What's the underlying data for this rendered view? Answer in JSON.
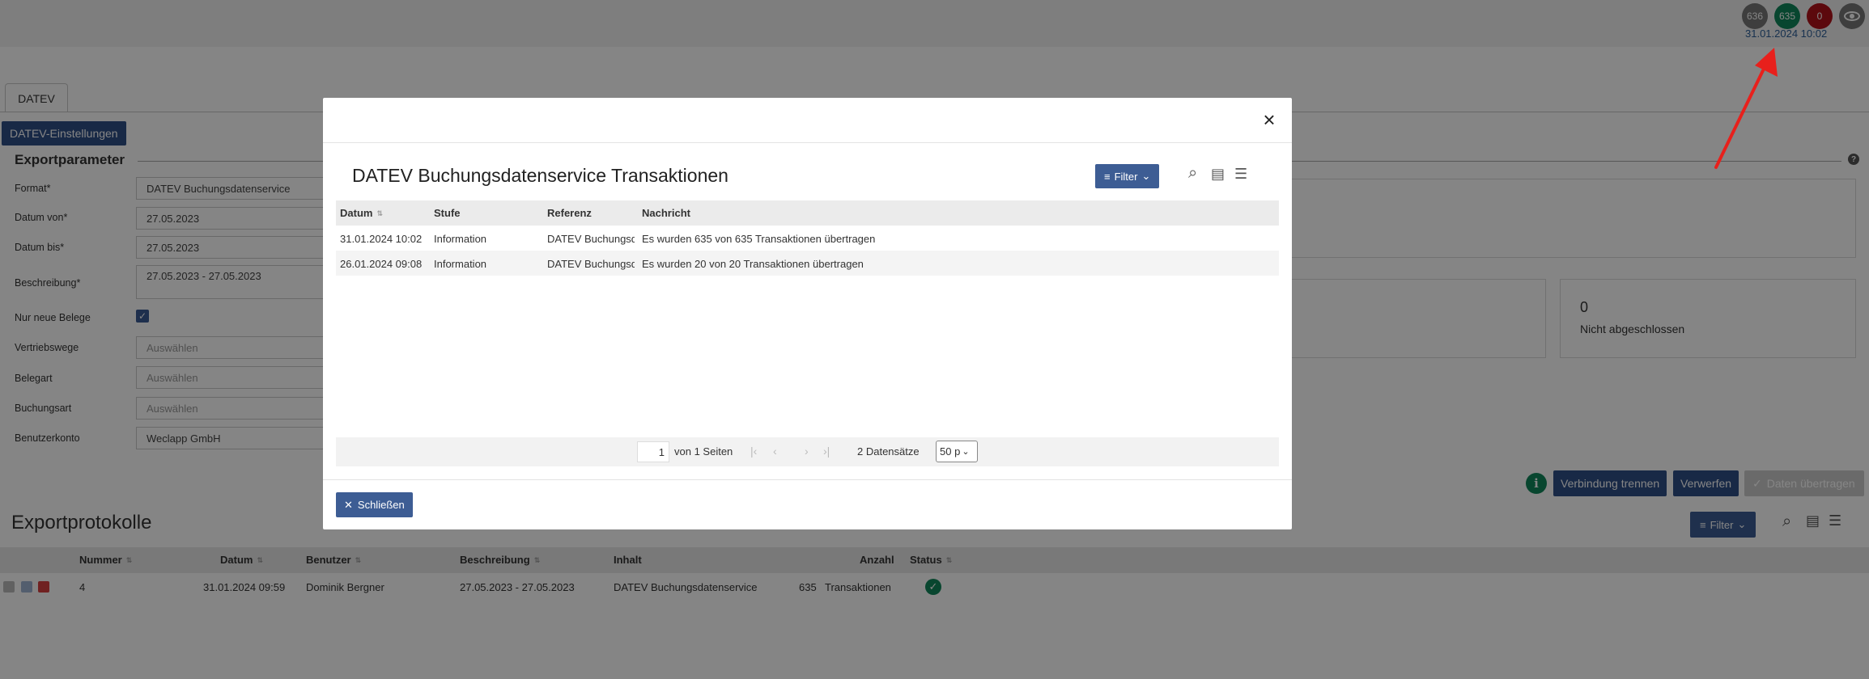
{
  "status": {
    "badges": [
      "636",
      "635",
      "0"
    ],
    "date": "31.01.2024 10:02"
  },
  "tab": {
    "label": "DATEV"
  },
  "settings_button": "DATEV-Einstellungen",
  "export_params": {
    "title": "Exportparameter",
    "help": "?",
    "fields": [
      {
        "label": "Format*",
        "value": "DATEV Buchungsdatenservice"
      },
      {
        "label": "Datum von*",
        "value": "27.05.2023"
      },
      {
        "label": "Datum bis*",
        "value": "27.05.2023"
      },
      {
        "label": "Beschreibung*",
        "value": "27.05.2023 - 27.05.2023"
      },
      {
        "label": "Nur neue Belege",
        "checked": true
      },
      {
        "label": "Vertriebswege",
        "placeholder": "Auswählen"
      },
      {
        "label": "Belegart",
        "placeholder": "Auswählen"
      },
      {
        "label": "Buchungsart",
        "placeholder": "Auswählen"
      },
      {
        "label": "Benutzerkonto",
        "value": "Weclapp GmbH"
      }
    ]
  },
  "summary_card": {
    "count": "0",
    "label": "Nicht abgeschlossen"
  },
  "actions": {
    "disconnect": "Verbindung trennen",
    "discard": "Verwerfen",
    "transfer": "Daten übertragen"
  },
  "protocol": {
    "title": "Exportprotokolle",
    "filter_label": "Filter",
    "columns": [
      "Nummer",
      "Datum",
      "Benutzer",
      "Beschreibung",
      "Inhalt",
      "Anzahl",
      "Status"
    ],
    "rows": [
      {
        "nummer": "4",
        "datum": "31.01.2024 09:59",
        "benutzer": "Dominik Bergner",
        "beschreibung": "27.05.2023 - 27.05.2023",
        "inhalt": "DATEV Buchungsdatenservice",
        "anzahl": "635",
        "anzahl_unit": "Transaktionen",
        "status": "ok"
      }
    ]
  },
  "modal": {
    "title": "DATEV Buchungsdatenservice Transaktionen",
    "filter_label": "Filter",
    "columns": [
      "Datum",
      "Stufe",
      "Referenz",
      "Nachricht"
    ],
    "rows": [
      {
        "datum": "31.01.2024 10:02",
        "stufe": "Information",
        "referenz": "DATEV Buchungsdatenservice",
        "nachricht": "Es wurden 635 von 635 Transaktionen übertragen"
      },
      {
        "datum": "26.01.2024 09:08",
        "stufe": "Information",
        "referenz": "DATEV Buchungsdatenservice",
        "nachricht": "Es wurden 20 von 20 Transaktionen übertragen"
      }
    ],
    "pager": {
      "page": "1",
      "of_pages": "von 1 Seiten",
      "records": "2 Datensätze",
      "per_page": "50 p"
    },
    "close_label": "Schließen"
  },
  "colors": {
    "primary": "#3d5d94",
    "success": "#11865a",
    "danger": "#b0121a",
    "annotation_arrow": "#e8201c"
  }
}
